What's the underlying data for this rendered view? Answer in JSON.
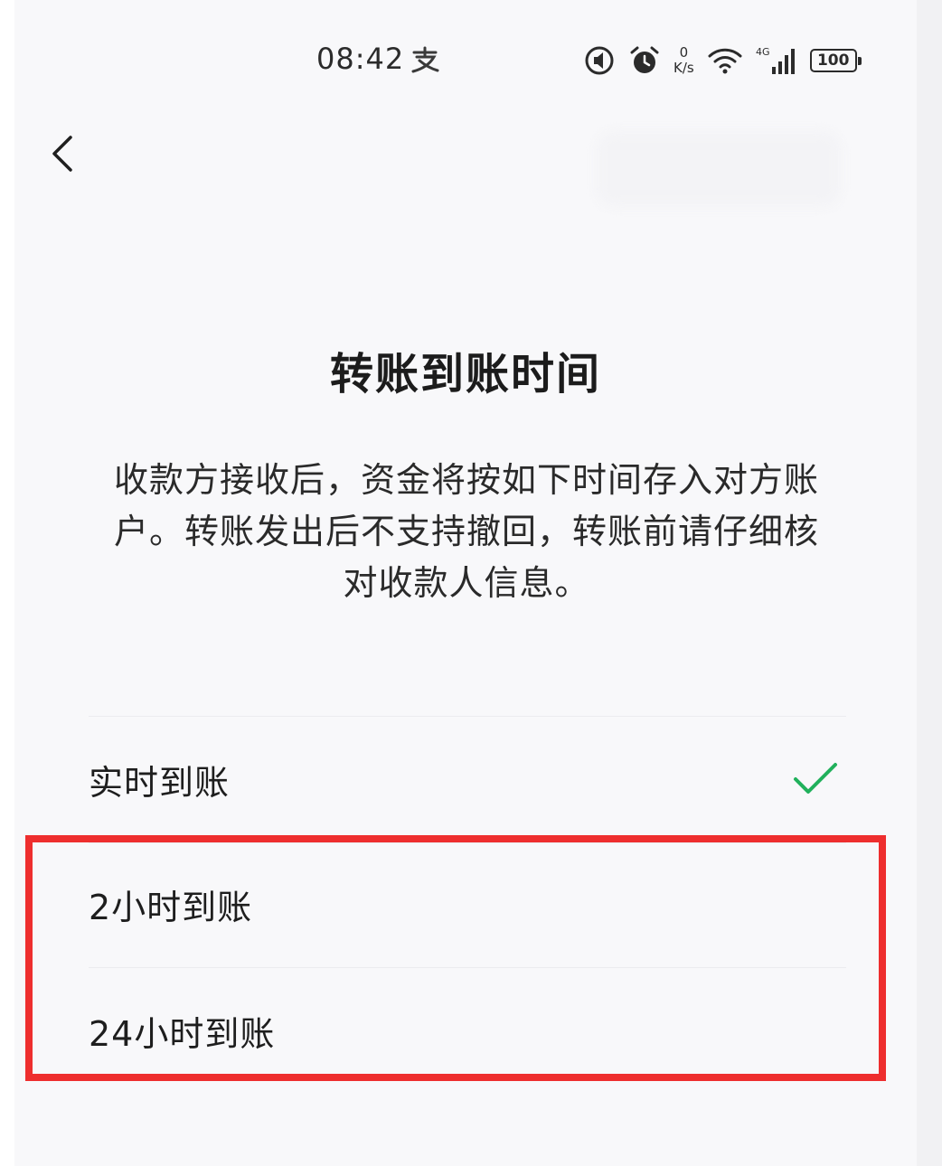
{
  "status_bar": {
    "time": "08:42",
    "net_speed_value": "0",
    "net_speed_unit": "K/s",
    "network_type": "4G",
    "battery": "100"
  },
  "nav": {
    "back_icon": "chevron-left-icon"
  },
  "page": {
    "title": "转账到账时间",
    "description": "收款方接收后，资金将按如下时间存入对方账户。转账发出后不支持撤回，转账前请仔细核对收款人信息。"
  },
  "options": [
    {
      "label": "实时到账",
      "selected": true
    },
    {
      "label": "2小时到账",
      "selected": false
    },
    {
      "label": "24小时到账",
      "selected": false
    }
  ],
  "colors": {
    "check": "#21b15c",
    "highlight": "#ee2e2e",
    "background": "#f8f8fa"
  }
}
